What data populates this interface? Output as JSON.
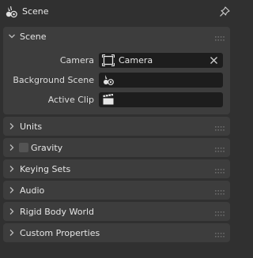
{
  "header": {
    "title": "Scene",
    "icon": "scene-icon",
    "pin_icon": "pin-icon"
  },
  "panels": [
    {
      "label": "Scene",
      "expanded": true,
      "fields": [
        {
          "label": "Camera",
          "value": "Camera",
          "icon": "camera-icon",
          "clearable": true
        },
        {
          "label": "Background Scene",
          "value": "",
          "icon": "scene-icon",
          "clearable": false
        },
        {
          "label": "Active Clip",
          "value": "",
          "icon": "clip-icon",
          "clearable": false
        }
      ]
    },
    {
      "label": "Units",
      "expanded": false
    },
    {
      "label": "Gravity",
      "expanded": false,
      "checkbox": true,
      "checked": false
    },
    {
      "label": "Keying Sets",
      "expanded": false
    },
    {
      "label": "Audio",
      "expanded": false
    },
    {
      "label": "Rigid Body World",
      "expanded": false
    },
    {
      "label": "Custom Properties",
      "expanded": false
    }
  ],
  "colors": {
    "background": "#303030",
    "panel": "#3d3d3d",
    "field": "#1d1d1d",
    "text": "#e6e6e6"
  }
}
